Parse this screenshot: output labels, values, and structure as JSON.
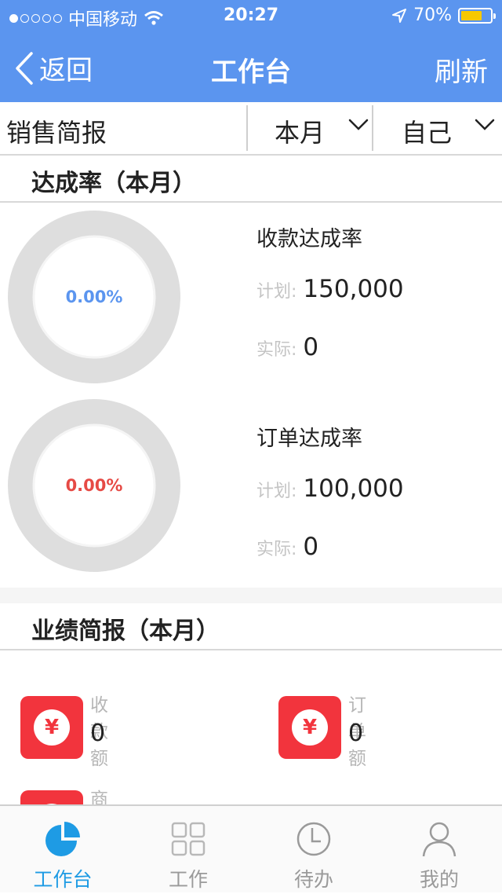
{
  "status_bar": {
    "carrier": "中国移动",
    "time": "20:27",
    "battery": "70%",
    "battery_level": 0.7
  },
  "nav": {
    "back_label": "返回",
    "title": "工作台",
    "refresh_label": "刷新"
  },
  "filter": {
    "title": "销售简报",
    "period_value": "本月",
    "owner_value": "自己"
  },
  "achievement": {
    "header": "达成率（本月）",
    "items": [
      {
        "title": "收款达成率",
        "ring_text": "0.00%",
        "ring_color": "#5b95ef",
        "plan_label": "计划:",
        "plan_value": "150,000",
        "actual_label": "实际:",
        "actual_value": "0"
      },
      {
        "title": "订单达成率",
        "ring_text": "0.00%",
        "ring_color": "#e64a45",
        "plan_label": "计划:",
        "plan_value": "100,000",
        "actual_label": "实际:",
        "actual_value": "0"
      }
    ]
  },
  "performance": {
    "header": "业绩简报（本月）",
    "currency_symbol": "¥",
    "items": [
      {
        "label": "收款额",
        "value": "0"
      },
      {
        "label": "订单额",
        "value": "0"
      },
      {
        "label": "商机额",
        "value": ""
      }
    ]
  },
  "tabs": [
    {
      "label": "工作台",
      "icon": "pie-chart-icon",
      "active": true
    },
    {
      "label": "工作",
      "icon": "grid-icon",
      "active": false
    },
    {
      "label": "待办",
      "icon": "clock-icon",
      "active": false
    },
    {
      "label": "我的",
      "icon": "user-icon",
      "active": false
    }
  ],
  "colors": {
    "brand": "#5b95ef",
    "accent_red": "#f2343d",
    "tab_active": "#1e9be4"
  }
}
